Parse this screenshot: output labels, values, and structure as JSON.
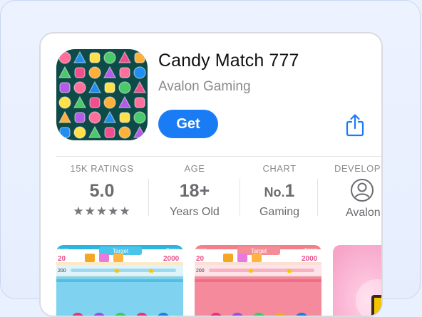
{
  "app": {
    "title": "Candy Match 777",
    "developer": "Avalon Gaming",
    "get_label": "Get"
  },
  "stats": {
    "ratings": {
      "label": "15K RATINGS",
      "value": "5.0",
      "stars": "★★★★★"
    },
    "age": {
      "label": "AGE",
      "value": "18+",
      "sub": "Years Old"
    },
    "chart": {
      "label": "CHART",
      "prefix": "No.",
      "value": "1",
      "sub": "Gaming"
    },
    "developer": {
      "label": "DEVELOPE",
      "sub": "Avalon"
    }
  },
  "screenshots": {
    "one": {
      "moves": "oves",
      "target": "Target",
      "score": "Score",
      "left_num": "20",
      "right_num": "2000",
      "bar_num": "200"
    },
    "two": {
      "moves": "oves",
      "target": "Target",
      "score": "Score",
      "left_num": "20",
      "right_num": "2000",
      "bar_num": "200"
    }
  },
  "icons": [
    "candy-grid-icon",
    "share-icon",
    "person-icon",
    "star-icon"
  ]
}
